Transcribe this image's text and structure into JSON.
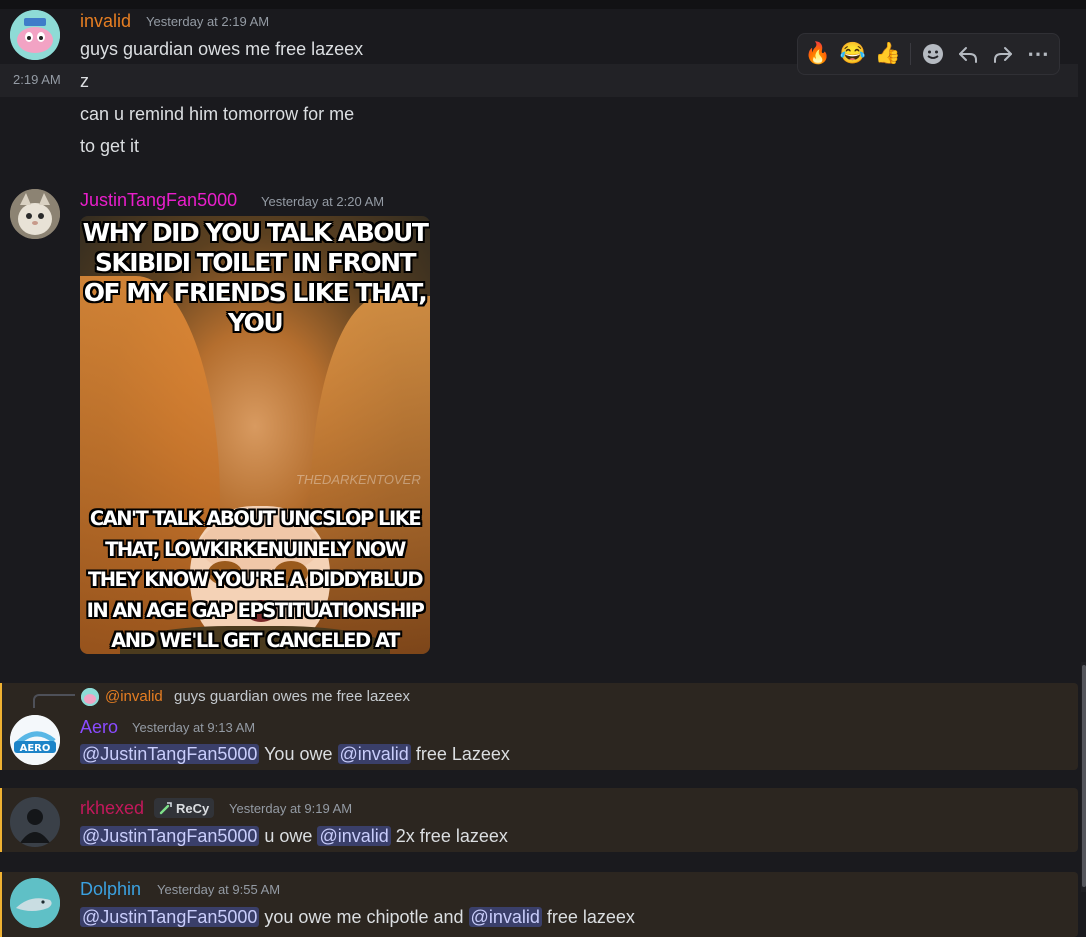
{
  "toolbar": {
    "reactions": [
      "🔥",
      "😂",
      "👍"
    ],
    "more": "⋯"
  },
  "messages": [
    {
      "author": "invalid",
      "timestamp": "Yesterday at 2:19 AM",
      "author_color": "#e67e22",
      "lines": [
        "guys guardian owes me free lazeex",
        "z",
        "can u remind him tomorrow for me",
        "to get it"
      ],
      "hover_time": "2:19 AM"
    },
    {
      "author": "JustinTangFan5000",
      "timestamp": "Yesterday at 2:20 AM",
      "author_color": "#e91ecb",
      "meme": {
        "top_text": "WHY DID YOU TALK ABOUT SKIBIDI TOILET IN FRONT OF MY FRIENDS LIKE THAT, YOU",
        "bottom_text": "CAN'T TALK ABOUT UNCSLOP LIKE THAT, LOWKIRKENUINELY NOW THEY KNOW YOU'RE A DIDDYBLUD IN AN AGE GAP EPSTITUATIONSHIP AND WE'LL GET CANCELED AT RECESS",
        "watermark": "THEDARKENTOVER"
      }
    },
    {
      "reply": {
        "mention": "@invalid",
        "text": "guys guardian owes me free lazeex"
      },
      "author": "Aero",
      "timestamp": "Yesterday at 9:13 AM",
      "author_color": "#8a4bff",
      "avatar_text": "AERO",
      "parts": {
        "m1": "@JustinTangFan5000",
        "t1": "You owe",
        "m2": "@invalid",
        "t2": "free Lazeex"
      }
    },
    {
      "author": "rkhexed",
      "timestamp": "Yesterday at 9:19 AM",
      "author_color": "#c2185b",
      "tag": "ReCy",
      "parts": {
        "m1": "@JustinTangFan5000",
        "t1": "u owe",
        "m2": "@invalid",
        "t2": "2x free lazeex"
      }
    },
    {
      "author": "Dolphin",
      "timestamp": "Yesterday at 9:55 AM",
      "author_color": "#3ba1e0",
      "parts": {
        "m1": "@JustinTangFan5000",
        "t1": "you owe me chipotle and",
        "m2": "@invalid",
        "t2": "free lazeex"
      }
    }
  ]
}
